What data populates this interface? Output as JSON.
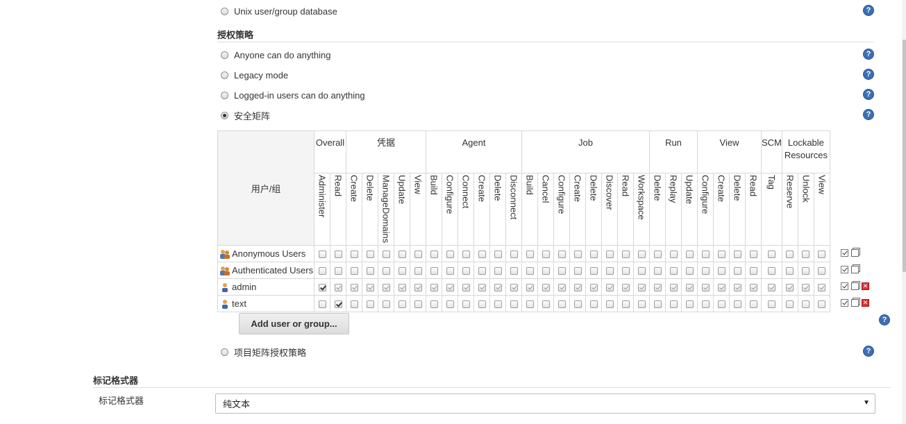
{
  "security_realm": {
    "unix_label": "Unix user/group database"
  },
  "authorization": {
    "section_title": "授权策略",
    "options": [
      {
        "label": "Anyone can do anything",
        "checked": false
      },
      {
        "label": "Legacy mode",
        "checked": false
      },
      {
        "label": "Logged-in users can do anything",
        "checked": false
      },
      {
        "label": "安全矩阵",
        "checked": true
      }
    ],
    "project_matrix_label": "项目矩阵授权策略",
    "help_glyph": "?"
  },
  "matrix": {
    "corner_label": "用户/组",
    "groups": [
      {
        "label": "Overall",
        "perms": [
          "Administer",
          "Read"
        ]
      },
      {
        "label": "凭据",
        "perms": [
          "Create",
          "Delete",
          "ManageDomains",
          "Update",
          "View"
        ]
      },
      {
        "label": "Agent",
        "perms": [
          "Build",
          "Configure",
          "Connect",
          "Create",
          "Delete",
          "Disconnect"
        ]
      },
      {
        "label": "Job",
        "perms": [
          "Build",
          "Cancel",
          "Configure",
          "Create",
          "Delete",
          "Discover",
          "Read",
          "Workspace"
        ]
      },
      {
        "label": "Run",
        "perms": [
          "Delete",
          "Replay",
          "Update"
        ]
      },
      {
        "label": "View",
        "perms": [
          "Configure",
          "Create",
          "Delete",
          "Read"
        ]
      },
      {
        "label": "SCM",
        "perms": [
          "Tag"
        ]
      },
      {
        "label": "Lockable Resources",
        "perms": [
          "Reserve",
          "Unlock",
          "View"
        ]
      }
    ],
    "rows": [
      {
        "name": "Anonymous Users",
        "icon": "group-icon",
        "checked": [],
        "grey": [],
        "deletable": false
      },
      {
        "name": "Authenticated Users",
        "icon": "group-icon",
        "checked": [],
        "grey": [],
        "deletable": false
      },
      {
        "name": "admin",
        "icon": "user-icon",
        "checked": [
          0
        ],
        "grey": "rest",
        "deletable": true
      },
      {
        "name": "text",
        "icon": "user-icon",
        "checked": [
          1
        ],
        "grey": [],
        "deletable": true
      }
    ]
  },
  "add_button_label": "Add user or group...",
  "markup": {
    "section_title": "标记格式器",
    "field_label": "标记格式器",
    "selected": "纯文本"
  },
  "colors": {
    "help_blue": "#3c6fb4",
    "delete_red": "#d33333"
  }
}
